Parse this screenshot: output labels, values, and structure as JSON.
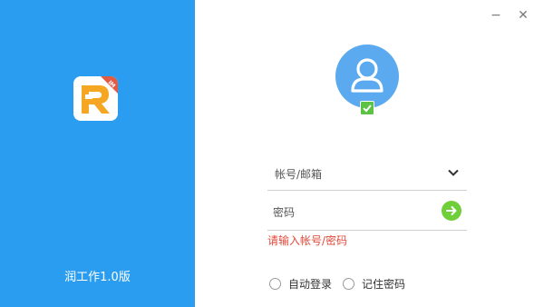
{
  "app": {
    "logo_badge": "IM",
    "logo_letter": "R",
    "version_label": "润工作1.0版"
  },
  "window_controls": {
    "minimize": "−",
    "close": "✕"
  },
  "login_form": {
    "account_placeholder": "帐号/邮箱",
    "password_placeholder": "密码",
    "error_message": "请输入帐号/密码",
    "auto_login_label": "自动登录",
    "remember_password_label": "记住密码"
  },
  "colors": {
    "panel_blue": "#2b9df0",
    "avatar_blue": "#5baaf0",
    "status_green": "#5cc243",
    "button_green": "#6fcf3a",
    "error_red": "#e0493a",
    "logo_orange": "#f5a623"
  },
  "icons": {
    "avatar": "user-icon",
    "badge": "checkmark-icon",
    "dropdown": "chevron-down-icon",
    "submit": "arrow-right-icon"
  }
}
